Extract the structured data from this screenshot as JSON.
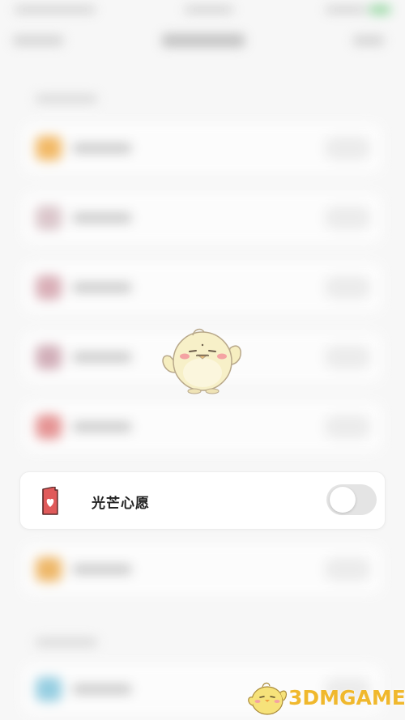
{
  "card": {
    "label": "光芒心愿",
    "toggle_on": false
  },
  "watermark": {
    "text": "3DMGAME"
  },
  "colors": {
    "card_icon": "#e05a5a",
    "toggle_off": "#e4e4e4",
    "watermark": "#f0b82d",
    "mascot": "#f6eec0"
  },
  "icons": {
    "card": "heart-card-icon",
    "mascot": "chick-mascot-icon",
    "watermark": "3dm-chick-logo-icon"
  }
}
